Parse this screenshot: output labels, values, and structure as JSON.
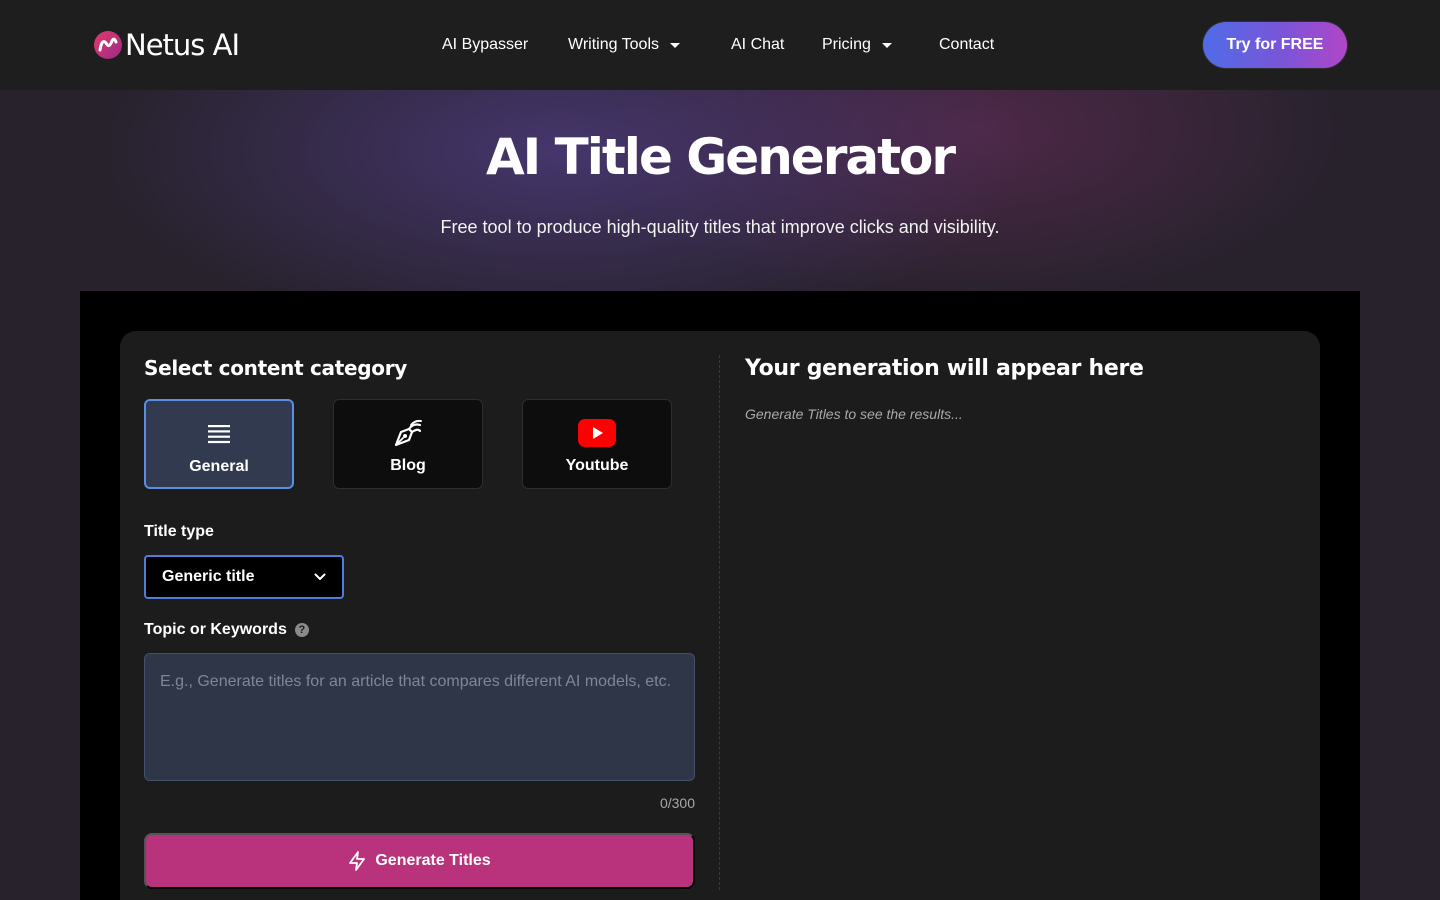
{
  "navbar": {
    "logo_text": "Netus AI",
    "items": [
      {
        "label": "AI Bypasser",
        "has_dropdown": false
      },
      {
        "label": "Writing Tools",
        "has_dropdown": true
      },
      {
        "label": "AI Chat",
        "has_dropdown": false
      },
      {
        "label": "Pricing",
        "has_dropdown": true
      },
      {
        "label": "Contact",
        "has_dropdown": false
      }
    ],
    "cta_label": "Try for FREE"
  },
  "hero": {
    "title": "AI Title Generator",
    "subtitle": "Free tool to produce high-quality titles that improve clicks and visibility."
  },
  "form": {
    "category_heading": "Select content category",
    "categories": [
      {
        "label": "General",
        "icon": "list-lines-icon",
        "selected": true
      },
      {
        "label": "Blog",
        "icon": "pen-nib-icon",
        "selected": false
      },
      {
        "label": "Youtube",
        "icon": "youtube-icon",
        "selected": false
      }
    ],
    "title_type_label": "Title type",
    "title_type_value": "Generic title",
    "topic_label": "Topic or Keywords",
    "topic_placeholder": "E.g., Generate titles for an article that compares different AI models, etc.",
    "counter": "0/300",
    "generate_label": "Generate Titles"
  },
  "results": {
    "heading": "Your generation will appear here",
    "hint": "Generate Titles to see the results..."
  },
  "colors": {
    "accent_pink": "#b8327c",
    "accent_blue": "#4f7ddc",
    "youtube_red": "#ff0000"
  }
}
